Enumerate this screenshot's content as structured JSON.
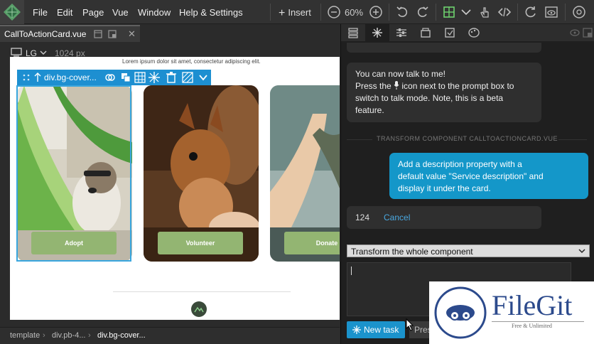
{
  "menubar": {
    "items": [
      "File",
      "Edit",
      "Page",
      "Vue",
      "Window",
      "Help & Settings"
    ],
    "insert_label": "Insert",
    "zoom": "60%"
  },
  "document": {
    "tab_name": "CallToActionCard.vue",
    "breakpoint": "LG",
    "width": "1024 px"
  },
  "canvas": {
    "lorem": "Lorem ipsum dolor sit amet, consectetur adipiscing elit.",
    "cards": [
      {
        "button": "Adopt"
      },
      {
        "button": "Volunteer"
      },
      {
        "button": "Donate"
      }
    ]
  },
  "selection": {
    "label": "div.bg-cover..."
  },
  "breadcrumbs": [
    "template",
    "div.pb-4...",
    "div.bg-cover..."
  ],
  "chat": {
    "ai_message": "You can now talk to me!\nPress the 🎤 icon next to the prompt box to switch to talk mode. Note, this is a beta feature.",
    "ai_line1": "You can now talk to me!",
    "ai_line2a": "Press the",
    "ai_line2b": "icon next to the prompt box to",
    "ai_line3": "switch to talk mode. Note, this is a beta",
    "ai_line4": "feature.",
    "section_label": "TRANSFORM COMPONENT CALLTOACTIONCARD.VUE",
    "user_line1": "Add a description property with a",
    "user_line2": "default value \"Service description\" and",
    "user_line3": "display it under the card.",
    "token_count": "124",
    "cancel_label": "Cancel",
    "mode": "Transform the whole component",
    "new_task_label": "New task",
    "press_label": "Pres"
  },
  "watermark": {
    "brand": "FileGit",
    "tagline": "Free & Unlimited"
  },
  "colors": {
    "accent": "#1d8fd1",
    "card_button": "#93b572",
    "user_bubble": "#1497c9"
  }
}
